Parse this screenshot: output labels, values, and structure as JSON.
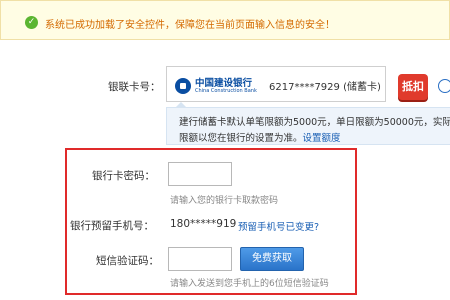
{
  "notice": {
    "icon": "check-circle-icon",
    "text": "系统已成功加载了安全控件，保障您在当前页面输入信息的安全！"
  },
  "bank_card": {
    "label": "银联卡号：",
    "bank_name": "中国建设银行",
    "bank_name_en": "China Construction Bank",
    "card_number": "6217****7929 (储蓄卡)",
    "deduct_badge": "抵扣",
    "info_icon": "info-icon"
  },
  "limit": {
    "line1": "建行储蓄卡默认单笔限额为5000元，单日限额为50000元，实际",
    "line2": "限额以您在银行的设置为准。",
    "link": "设置额度"
  },
  "form": {
    "password_label": "银行卡密码：",
    "password_hint": "请输入您的银行卡取款密码",
    "phone_label": "银行预留手机号：",
    "phone_value": "180*****919",
    "phone_link": "预留手机号已变更?",
    "sms_label": "短信验证码：",
    "sms_button": "免费获取",
    "sms_hint": "请输入发送到您手机上的6位短信验证码"
  },
  "colors": {
    "notice_text": "#d46a00",
    "link": "#1a5fb4",
    "highlight_frame": "#e02a2a",
    "button": "#2a73c9"
  }
}
